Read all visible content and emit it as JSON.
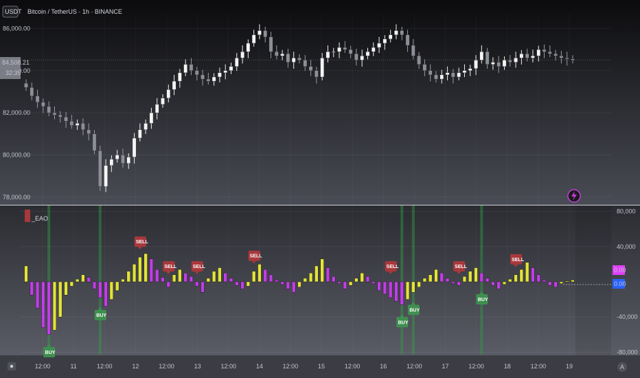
{
  "symbol": {
    "currency_badge": "USDT",
    "title": "Bitcoin / TetherUS · 1h · BINANCE"
  },
  "indicator": {
    "name": "_EAO",
    "value_magenta": "0.00",
    "value_blue": "0.00"
  },
  "price_axis": {
    "ticks": [
      "86,000.00",
      "84,000.00",
      "82,000.00",
      "80,000.00",
      "78,000.00"
    ],
    "last_price": "84,508.21",
    "countdown": "32:35"
  },
  "osc_axis": {
    "ticks": [
      "80,000",
      "40,000",
      "-40,000",
      "-80,000"
    ]
  },
  "time_axis": {
    "ticks": [
      "12:00",
      "11",
      "12:00",
      "12",
      "12:00",
      "13",
      "12:00",
      "14",
      "12:00",
      "15",
      "12:00",
      "16",
      "12:00",
      "17",
      "12:00",
      "18",
      "12:00",
      "19"
    ]
  },
  "colors": {
    "up_bar": "#e2e33a",
    "down_bar": "#c13ee6",
    "buy": "#3f8f4f",
    "sell": "#a8383c",
    "blue_tag": "#2962ff",
    "magenta_tag": "#e040fb"
  },
  "chart_data": [
    {
      "type": "candlestick",
      "title": "Bitcoin / TetherUS · 1h · BINANCE",
      "ylim": [
        77700,
        86700
      ],
      "close": [
        83200,
        82800,
        82500,
        82300,
        82000,
        81900,
        81800,
        81600,
        81400,
        81500,
        81200,
        81000,
        80200,
        78500,
        79500,
        79800,
        80000,
        79600,
        79900,
        80800,
        81200,
        81500,
        82000,
        82400,
        82700,
        83100,
        83500,
        83900,
        84300,
        84000,
        83800,
        83600,
        83500,
        83700,
        83900,
        84000,
        84200,
        84600,
        84900,
        85300,
        85700,
        85900,
        85600,
        84900,
        84700,
        84800,
        84400,
        84600,
        84500,
        84200,
        84000,
        83700,
        84600,
        84900,
        84900,
        85100,
        85000,
        84800,
        84500,
        84700,
        84900,
        85100,
        85300,
        85500,
        85700,
        85900,
        85700,
        85200,
        84700,
        84300,
        84000,
        83800,
        83600,
        83800,
        83900,
        83700,
        83900,
        84000,
        84100,
        84500,
        84900,
        84300,
        84400,
        84200,
        84500,
        84400,
        84600,
        84800,
        84600,
        84700,
        85000,
        84900,
        84800,
        84700,
        84600,
        84550,
        84500
      ],
      "price_scale": "linear"
    },
    {
      "type": "bar",
      "name": "_EAO",
      "ylim": [
        -82000,
        82000
      ],
      "values": [
        18000,
        -15000,
        -30000,
        -52000,
        -60000,
        -55000,
        -40000,
        -15000,
        -5000,
        3000,
        8000,
        5000,
        -8000,
        -18000,
        -28000,
        -20000,
        -10000,
        3000,
        12000,
        20000,
        28000,
        32000,
        26000,
        14000,
        5000,
        -6000,
        8000,
        14000,
        10000,
        6000,
        -5000,
        -12000,
        4000,
        12000,
        16000,
        10000,
        4000,
        -4000,
        -8000,
        -5000,
        12000,
        20000,
        14000,
        8000,
        2000,
        -3000,
        -8000,
        -12000,
        -6000,
        4000,
        10000,
        18000,
        26000,
        16000,
        6000,
        -2000,
        -8000,
        -4000,
        4000,
        10000,
        6000,
        -2000,
        -10000,
        -14000,
        -18000,
        -22000,
        -26000,
        -20000,
        -12000,
        -6000,
        4000,
        8000,
        14000,
        10000,
        4000,
        -2000,
        -4000,
        6000,
        12000,
        16000,
        10000,
        4000,
        -4000,
        -8000,
        -3000,
        3000,
        8000,
        14000,
        22000,
        16000,
        8000,
        2000,
        -4000,
        -6000,
        -2000,
        1000,
        2000
      ],
      "buy_signals": [
        "BUY",
        "BUY",
        "BUY",
        "BUY",
        "BUY"
      ],
      "sell_signals": [
        "SELL",
        "SELL",
        "SELL",
        "SELL",
        "SELL",
        "SELL",
        "SELL"
      ]
    }
  ]
}
